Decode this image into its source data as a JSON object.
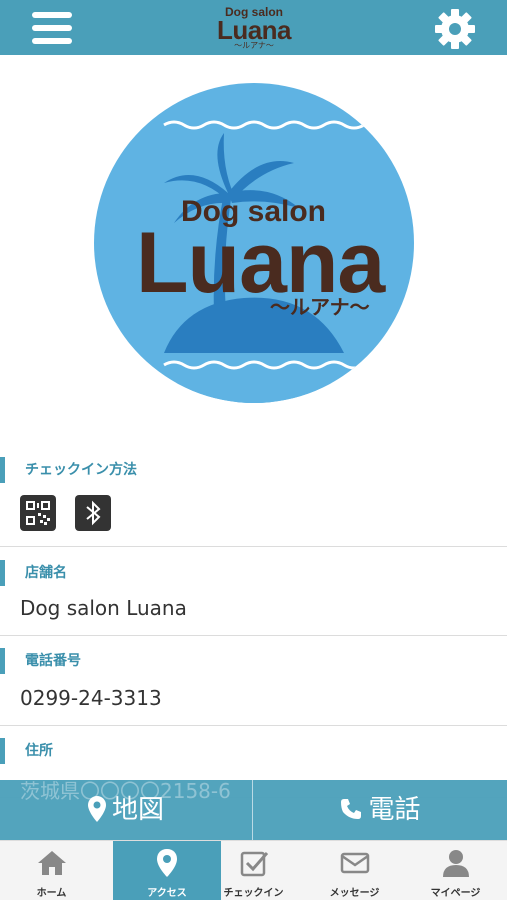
{
  "header": {
    "logo_small": "Dog salon",
    "logo_big": "Luana",
    "logo_kana": "〜ルアナ〜"
  },
  "logo": {
    "small": "Dog salon",
    "big": "Luana",
    "kana": "〜ルアナ〜"
  },
  "checkin": {
    "label": "チェックイン方法",
    "methods": [
      "qr-code-icon",
      "bluetooth-icon"
    ]
  },
  "store": {
    "label": "店舗名",
    "value": "Dog salon Luana"
  },
  "phone": {
    "label": "電話番号",
    "value": "0299-24-3313"
  },
  "address": {
    "label": "住所",
    "value": "茨城県〇〇〇〇2158-6"
  },
  "actions": {
    "map_label": "地図",
    "tel_label": "電話"
  },
  "nav": {
    "items": [
      {
        "label": "ホーム",
        "icon": "home-icon"
      },
      {
        "label": "アクセス",
        "icon": "map-pin-icon"
      },
      {
        "label": "チェックイン",
        "icon": "checkin-icon"
      },
      {
        "label": "メッセージ",
        "icon": "mail-icon"
      },
      {
        "label": "マイページ",
        "icon": "user-icon"
      }
    ],
    "active_index": 1
  },
  "colors": {
    "primary": "#4a9fb9",
    "logo_blue": "#5fb3e3",
    "logo_brown": "#4a2b1f"
  }
}
